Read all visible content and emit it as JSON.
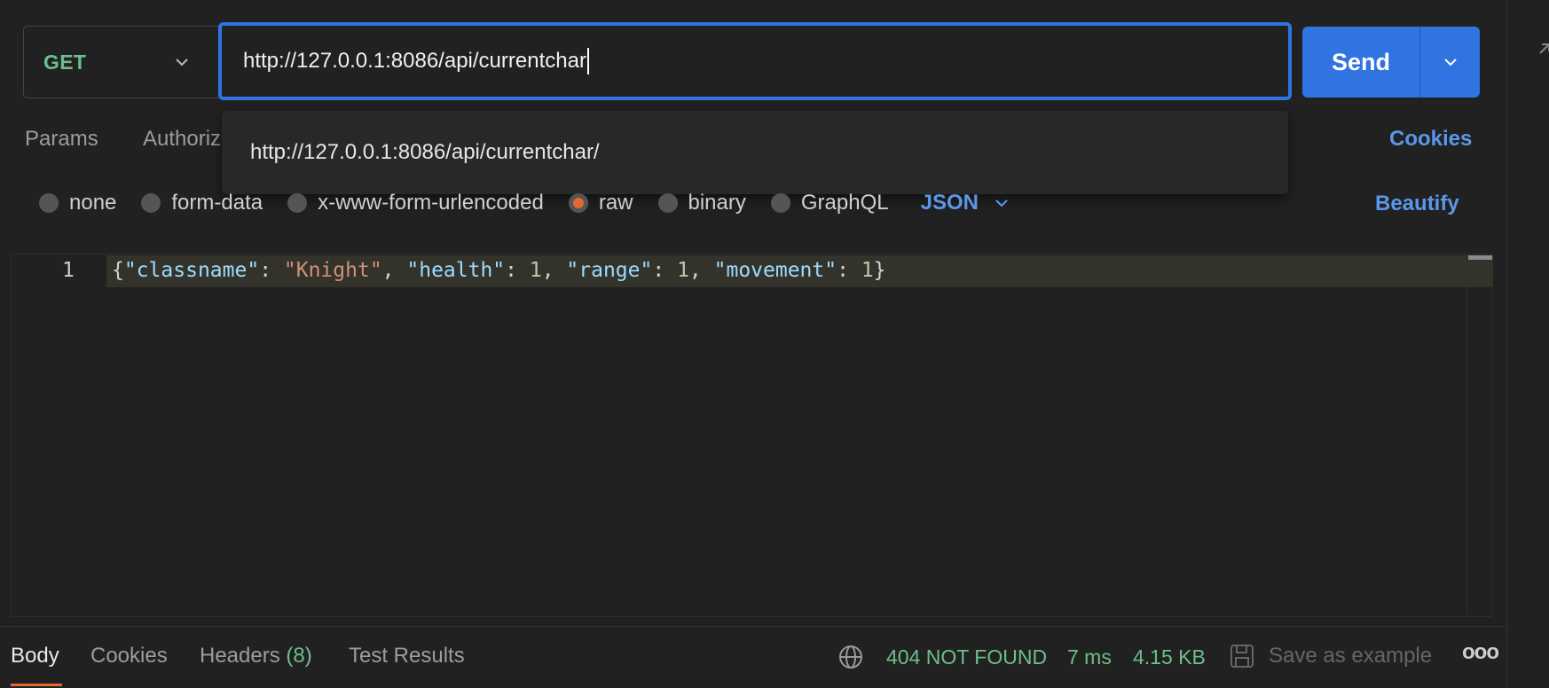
{
  "request": {
    "method": "GET",
    "url": "http://127.0.0.1:8086/api/currentchar",
    "send_label": "Send"
  },
  "tabs": {
    "params": "Params",
    "authorization": "Authoriz",
    "cookies": "Cookies"
  },
  "autocomplete": {
    "suggestion": "http://127.0.0.1:8086/api/currentchar/"
  },
  "body_types": {
    "options": [
      "none",
      "form-data",
      "x-www-form-urlencoded",
      "raw",
      "binary",
      "GraphQL"
    ],
    "selected": "raw",
    "format": "JSON",
    "beautify": "Beautify"
  },
  "editor": {
    "line_number": "1",
    "tokens": {
      "open": "{",
      "k1": "\"classname\"",
      "v1": "\"Knight\"",
      "k2": "\"health\"",
      "v2": "1",
      "k3": "\"range\"",
      "v3": "1",
      "k4": "\"movement\"",
      "v4": "1",
      "close": "}",
      "colon": ": ",
      "comma": ", "
    }
  },
  "response_tabs": {
    "body": "Body",
    "cookies": "Cookies",
    "headers": "Headers",
    "headers_count": "(8)",
    "tests": "Test Results"
  },
  "status": {
    "code": "404 NOT FOUND",
    "time": "7 ms",
    "size": "4.15 KB",
    "save_example": "Save as example",
    "more": "ooo"
  },
  "colors": {
    "accent_blue": "#2f74e0",
    "link_blue": "#5b97e8",
    "status_green": "#6bbf8a",
    "raw_orange": "#e36a2f"
  }
}
